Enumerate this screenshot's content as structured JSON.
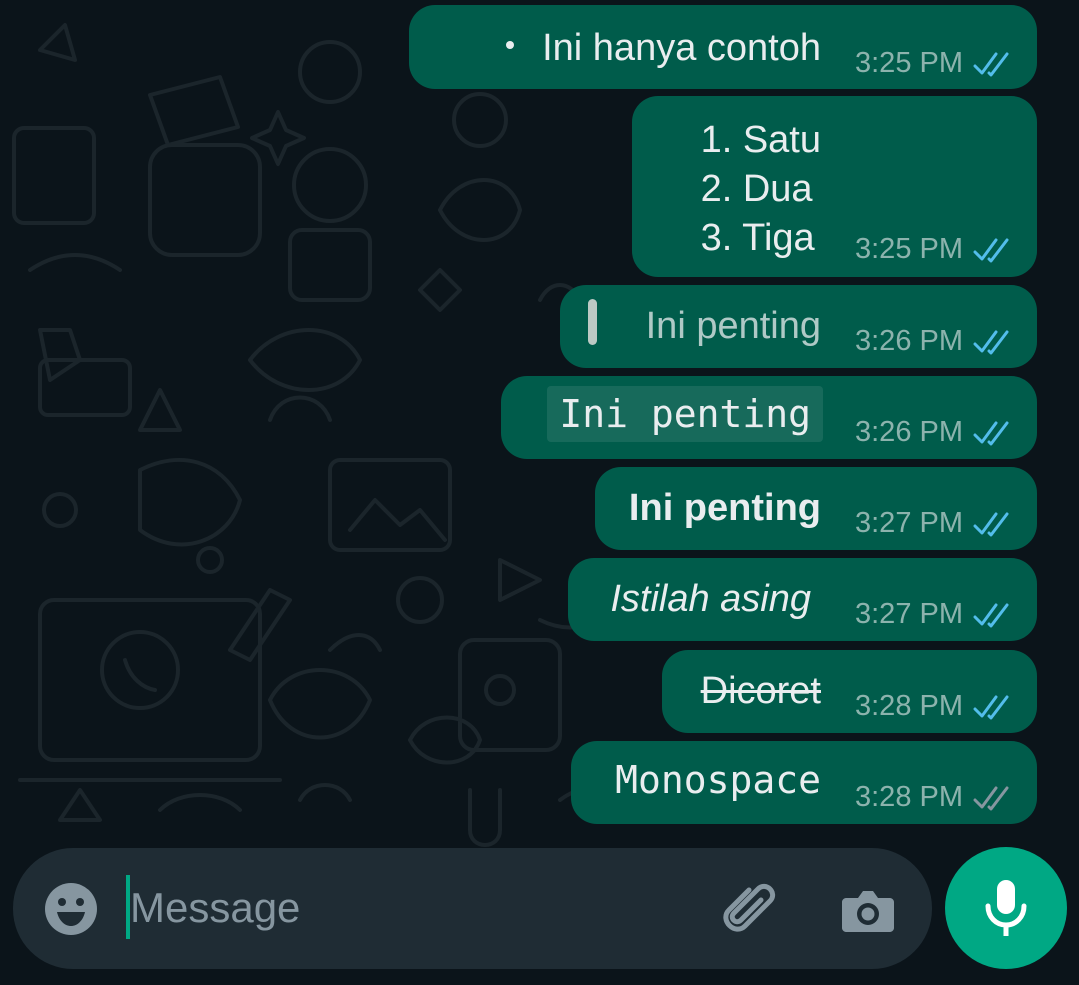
{
  "messages": [
    {
      "text": "Ini hanya contoh",
      "time": "3:25 PM",
      "status": "read",
      "format": "bullet"
    },
    {
      "lines": [
        "1. Satu",
        "2. Dua",
        "3. Tiga"
      ],
      "time": "3:25 PM",
      "status": "read",
      "format": "numbered-list"
    },
    {
      "text": "Ini penting",
      "time": "3:26 PM",
      "status": "read",
      "format": "quote"
    },
    {
      "text": "Ini penting",
      "time": "3:26 PM",
      "status": "read",
      "format": "inline-code"
    },
    {
      "text": "Ini penting",
      "time": "3:27 PM",
      "status": "read",
      "format": "bold"
    },
    {
      "text": "Istilah asing",
      "time": "3:27 PM",
      "status": "read",
      "format": "italic"
    },
    {
      "text": "Dicoret",
      "time": "3:28 PM",
      "status": "read",
      "format": "strikethrough"
    },
    {
      "text": "Monospace",
      "time": "3:28 PM",
      "status": "delivered",
      "format": "monospace"
    }
  ],
  "composer": {
    "placeholder": "Message",
    "value": "",
    "emoji_icon": "emoji-icon",
    "attach_icon": "paperclip-icon",
    "camera_icon": "camera-icon",
    "send_icon": "microphone-icon"
  },
  "colors": {
    "background": "#0b141a",
    "bubble_outgoing": "#005c4b",
    "tick_read": "#53bdeb",
    "tick_delivered": "#8696a0",
    "accent": "#00a884",
    "input_bar": "#1f2c34"
  }
}
